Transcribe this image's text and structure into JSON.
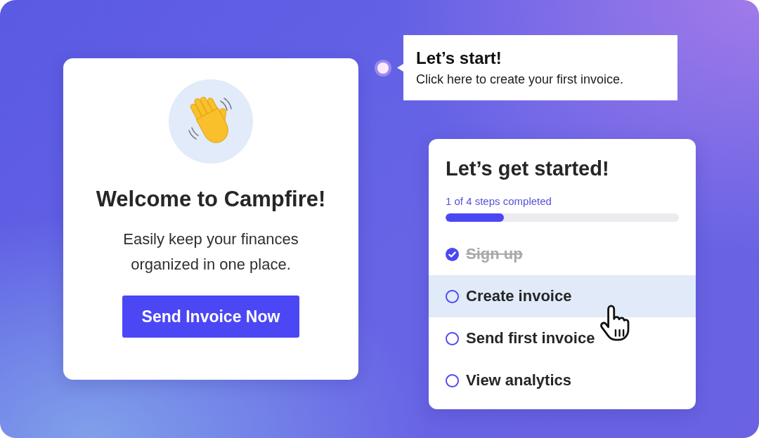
{
  "welcome_card": {
    "title": "Welcome to Campfire!",
    "description": "Easily keep your finances organized in one place.",
    "button": "Send Invoice Now"
  },
  "tooltip": {
    "title": "Let’s start!",
    "text": "Click here to create your first invoice."
  },
  "checklist": {
    "title": "Let’s get started!",
    "progress_text": "1 of 4 steps completed",
    "level": 0.25,
    "steps": [
      {
        "label": "Sign up",
        "checked": true,
        "selected": false
      },
      {
        "label": "Create invoice",
        "checked": false,
        "selected": true
      },
      {
        "label": "Send first invoice",
        "checked": false,
        "selected": false
      },
      {
        "label": "View analytics",
        "checked": false,
        "selected": false
      }
    ]
  }
}
